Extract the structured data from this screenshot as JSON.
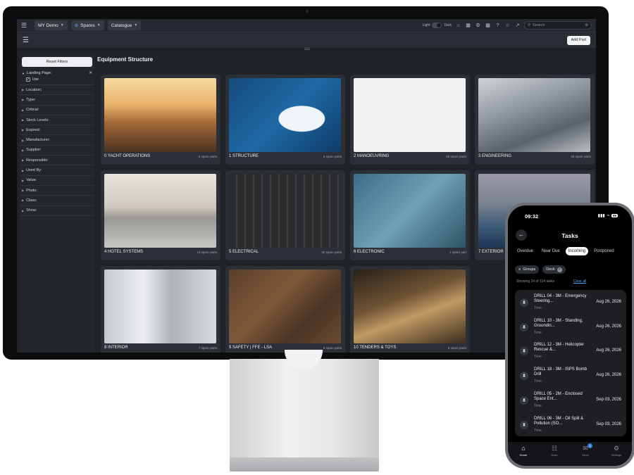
{
  "app": {
    "company_dropdown": "MY Demo",
    "module_dropdown": "Spares",
    "view_dropdown": "Catalogue",
    "theme_light": "Light",
    "theme_dark": "Dark",
    "search_placeholder": "Search",
    "add_part": "Add Part",
    "section_title": "Equipment Structure"
  },
  "sidebar": {
    "reset": "Reset Filters",
    "landing_label": "Landing Page:",
    "use_label": "Use",
    "filters": [
      "Location:",
      "Type:",
      "Critical:",
      "Stock Levels:",
      "Expired:",
      "Manufacturer:",
      "Supplier:",
      "Responsible:",
      "Used By:",
      "Value:",
      "Photo:",
      "Class:",
      "Show:"
    ]
  },
  "cards": [
    {
      "name": "0 YACHT OPERATIONS",
      "count": "0 spare parts"
    },
    {
      "name": "1 STRUCTURE",
      "count": "2 spare parts"
    },
    {
      "name": "2 MANOEUVRING",
      "count": "55 spare parts"
    },
    {
      "name": "3 ENGINEERING",
      "count": "35 spare parts"
    },
    {
      "name": "4 HOTEL SYSTEMS",
      "count": "13 spare parts"
    },
    {
      "name": "5 ELECTRICAL",
      "count": "32 spare parts"
    },
    {
      "name": "6 ELECTRONIC",
      "count": "1 spare part"
    },
    {
      "name": "7 EXTERIOR",
      "count": ""
    },
    {
      "name": "8 INTERIOR",
      "count": "7 spare parts"
    },
    {
      "name": "9 SAFETY | FFE - LSA",
      "count": "9 spare parts"
    },
    {
      "name": "10 TENDERS & TOYS",
      "count": "6 spare parts"
    }
  ],
  "phone": {
    "time": "09:32",
    "battery": "95",
    "title": "Tasks",
    "tabs": [
      "Overdue",
      "Near Due",
      "Incoming",
      "Postponed"
    ],
    "active_tab": "Incoming",
    "chip_groups": "Groups",
    "chip_deck": "Deck",
    "showing": "Showing 24 of 114 tasks",
    "clear_all": "Clear all",
    "tasks": [
      {
        "title": "DRILL 04 - 3M - Emergency Steering...",
        "sub": "Time",
        "date": "Aug 26, 2026"
      },
      {
        "title": "DRILL 10 - 3M - Standing, Groundin...",
        "sub": "Time",
        "date": "Aug 26, 2026"
      },
      {
        "title": "DRILL 12 - 3M - Helicopter Rescue &...",
        "sub": "Time",
        "date": "Aug 26, 2026"
      },
      {
        "title": "DRILL 18 - 3M - ISPS Bomb Drill",
        "sub": "Time",
        "date": "Aug 26, 2026"
      },
      {
        "title": "DRILL 05 - 2M - Enclosed Space Ent...",
        "sub": "Time",
        "date": "Sep 03, 2026"
      },
      {
        "title": "DRILL 06 - 3M - Oil Spill & Pollution (SO...",
        "sub": "Time",
        "date": "Sep 03, 2026"
      }
    ],
    "nav": [
      {
        "label": "Home"
      },
      {
        "label": "Scan"
      },
      {
        "label": "Inbox",
        "badge": "1"
      },
      {
        "label": "Settings"
      }
    ]
  }
}
